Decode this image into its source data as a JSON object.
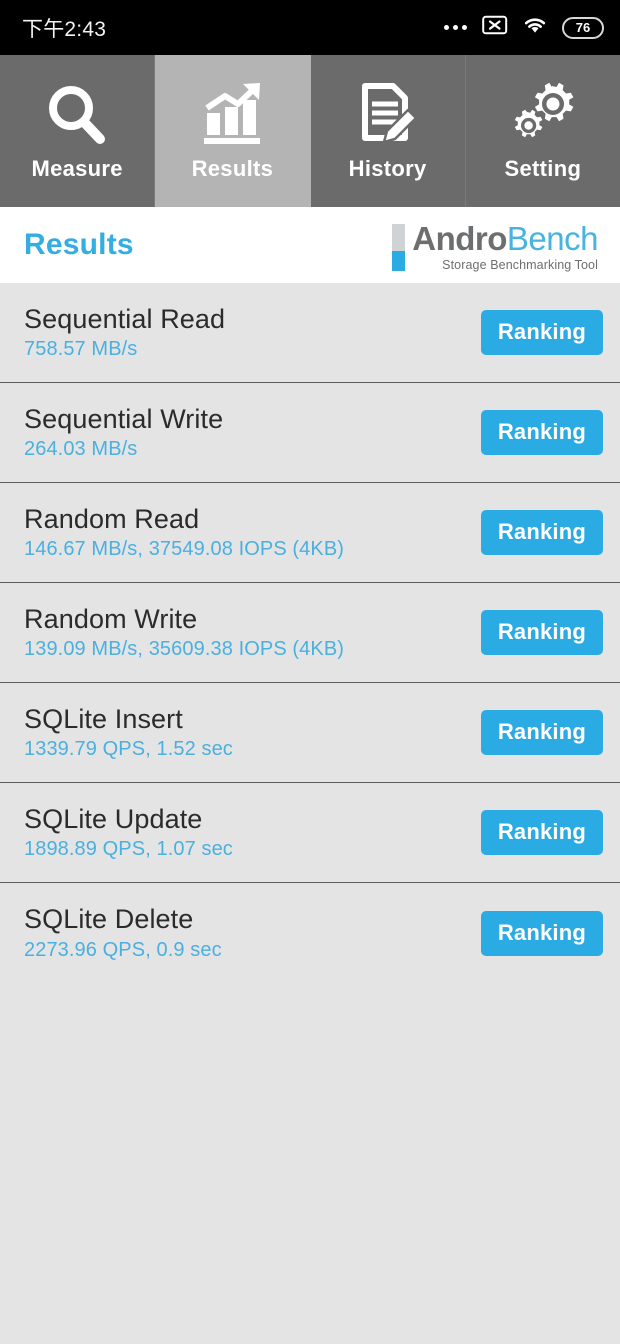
{
  "statusbar": {
    "time": "下午2:43",
    "overflow_icon": "more-dots-icon",
    "sim_icon": "no-sim-icon",
    "wifi_icon": "wifi-icon",
    "battery_icon": "battery-icon",
    "battery_level": "76"
  },
  "tabs": [
    {
      "label": "Measure",
      "icon": "magnifier-icon",
      "active": false
    },
    {
      "label": "Results",
      "icon": "bar-chart-arrow-icon",
      "active": true
    },
    {
      "label": "History",
      "icon": "document-pencil-icon",
      "active": false
    },
    {
      "label": "Setting",
      "icon": "gears-icon",
      "active": false
    }
  ],
  "header": {
    "title": "Results",
    "logo": {
      "word_dark": "Andro",
      "word_light": "Bench",
      "tagline": "Storage Benchmarking Tool"
    }
  },
  "colors": {
    "accent_blue": "#2babe3",
    "title_blue": "#34ade0",
    "value_blue": "#4ab0e0",
    "list_bg": "#e4e4e4",
    "tab_inactive": "#6b6b6b",
    "tab_active": "#b4b4b4",
    "statusbar_bg": "#000000"
  },
  "results": {
    "button_label": "Ranking",
    "rows": [
      {
        "title": "Sequential Read",
        "value": "758.57 MB/s"
      },
      {
        "title": "Sequential Write",
        "value": "264.03 MB/s"
      },
      {
        "title": "Random Read",
        "value": "146.67 MB/s, 37549.08 IOPS (4KB)"
      },
      {
        "title": "Random Write",
        "value": "139.09 MB/s, 35609.38 IOPS (4KB)"
      },
      {
        "title": "SQLite Insert",
        "value": "1339.79 QPS, 1.52 sec"
      },
      {
        "title": "SQLite Update",
        "value": "1898.89 QPS, 1.07 sec"
      },
      {
        "title": "SQLite Delete",
        "value": "2273.96 QPS, 0.9 sec"
      }
    ]
  }
}
